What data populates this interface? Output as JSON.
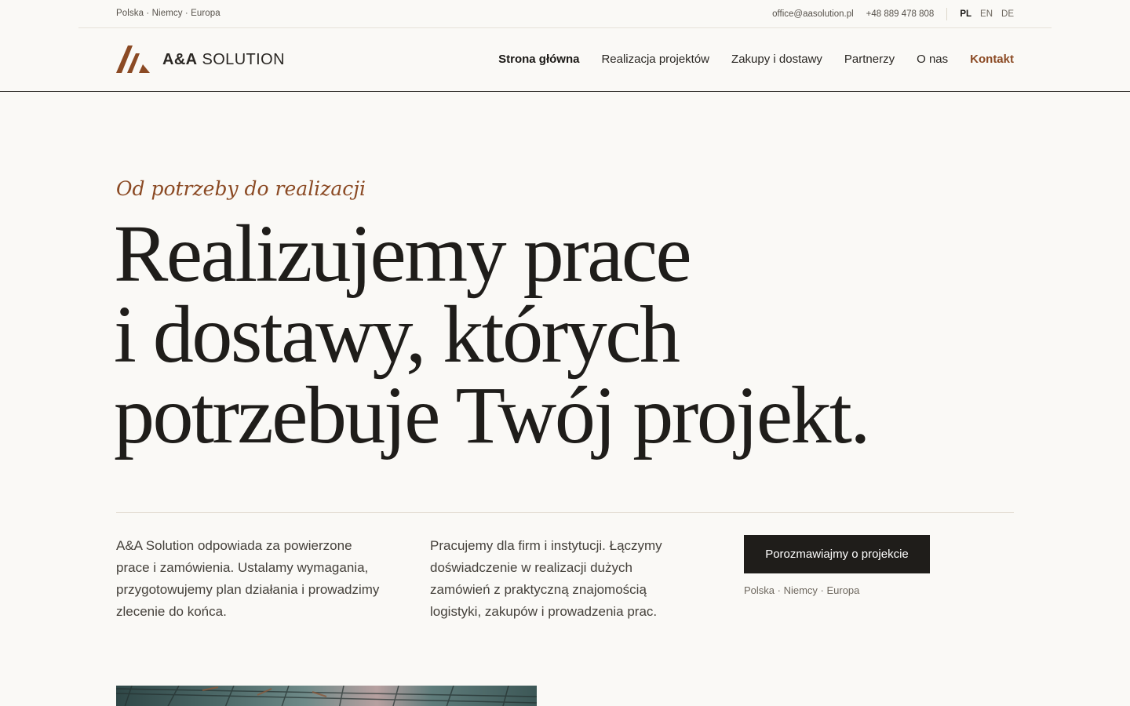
{
  "topbar": {
    "regions": "Polska · Niemcy · Europa",
    "email": "office@aasolution.pl",
    "phone": "+48 889 478 808",
    "languages": [
      "PL",
      "EN",
      "DE"
    ],
    "active_language": "PL"
  },
  "logo": {
    "brand_bold": "A&A",
    "brand_rest": " SOLUTION",
    "icon": "peaks-logo-icon",
    "color": "#8b4a24"
  },
  "nav": {
    "items": [
      "Strona główna",
      "Realizacja projektów",
      "Zakupy i dostawy",
      "Partnerzy",
      "O nas",
      "Kontakt"
    ],
    "active": "Strona główna",
    "accent_item": "Kontakt"
  },
  "hero": {
    "eyebrow": "Od potrzeby do realizacji",
    "headline_lines": [
      "Realizujemy prace",
      "i dostawy, których",
      "potrzebuje Twój projekt."
    ],
    "col1": "A&A Solution odpowiada za powierzone prace i zamówienia. Ustalamy wymagania, przygotowujemy plan działania i prowadzimy zlecenie do końca.",
    "col2": "Pracujemy dla firm i instytucji. Łączymy doświadczenie w realizacji dużych zamówień z praktyczną znajomością logistyki, zakupów i prowadzenia prac.",
    "cta_label": "Porozmawiajmy o projekcie",
    "cta_sub": "Polska · Niemcy · Europa"
  },
  "colors": {
    "background": "#faf9f6",
    "text": "#1f1d1a",
    "accent": "#8b4a24",
    "button": "#1f1d1a"
  }
}
